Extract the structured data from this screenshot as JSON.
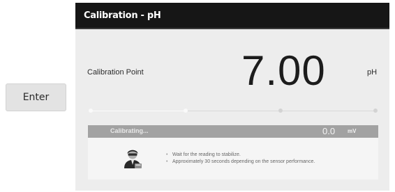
{
  "enter_button": {
    "label": "Enter"
  },
  "header": {
    "title": "Calibration - pH"
  },
  "calibration": {
    "label": "Calibration Point",
    "value": "7.00",
    "unit": "pH"
  },
  "progress": {
    "steps_total": 4,
    "steps_completed": 2
  },
  "status": {
    "message": "Calibrating...",
    "reading_value": "0.0",
    "reading_unit": "mV",
    "icon": "technician-icon",
    "instructions": [
      "Wait for the reading to stabilize.",
      "Approximately 30 seconds depending on the sensor performance."
    ]
  }
}
